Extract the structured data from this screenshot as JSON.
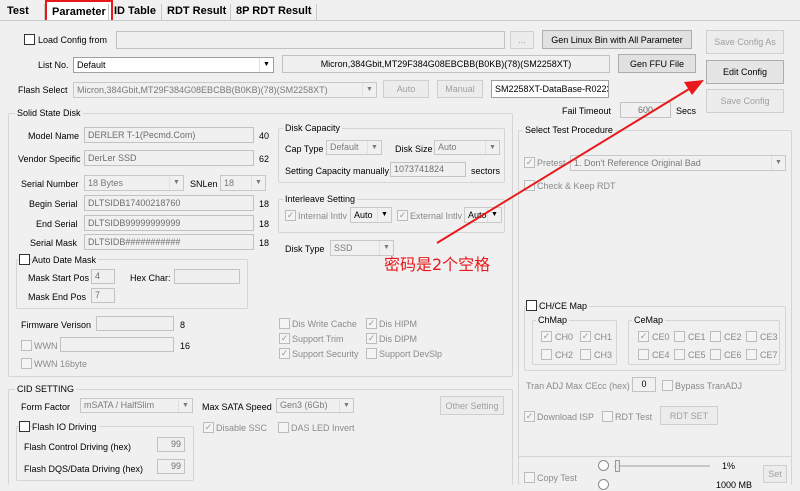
{
  "tabs": [
    "Test",
    "Parameter",
    "ID Table",
    "RDT Result",
    "8P RDT Result"
  ],
  "top": {
    "load_config_label": "Load Config from",
    "browse_label": "...",
    "gen_linux_label": "Gen Linux Bin with All Parameter",
    "save_config_as_label": "Save Config As",
    "list_no_label": "List No.",
    "list_no_value": "Default",
    "flash_info": "Micron,384Gbit,MT29F384G08EBCBB(B0KB)(78)(SM2258XT)",
    "gen_ffu_label": "Gen FFU File",
    "edit_config_label": "Edit Config",
    "flash_select_label": "Flash Select",
    "flash_select_value": "Micron,384Gbit,MT29F384G08EBCBB(B0KB)(78)(SM2258XT)",
    "auto_label": "Auto",
    "manual_label": "Manual",
    "database_value": "SM2258XT-DataBase-R0223",
    "save_config_label": "Save Config",
    "fail_timeout_label": "Fail Timeout",
    "fail_timeout_value": "600",
    "secs_label": "Secs"
  },
  "ssd": {
    "title": "Solid State Disk",
    "fields": [
      {
        "label": "Model Name",
        "value": "DERLER T-1(Pecmd.Com)",
        "num": "40"
      },
      {
        "label": "Vendor Specific",
        "value": "DerLer SSD",
        "num": "62"
      }
    ],
    "serial_label": "Serial Number",
    "serial_value": "18 Bytes",
    "snlen_label": "SNLen",
    "snlen_value": "18",
    "fields2": [
      {
        "label": "Begin Serial",
        "value": "DLTSIDB17400218760",
        "num": "18"
      },
      {
        "label": "End Serial",
        "value": "DLTSIDB99999999999",
        "num": "18"
      },
      {
        "label": "Serial Mask",
        "value": "DLTSIDB###########",
        "num": "18"
      }
    ],
    "auto_date_mask_label": "Auto Date Mask",
    "mask_start_label": "Mask Start Pos",
    "mask_start_value": "4",
    "hex_char_label": "Hex Char:",
    "mask_end_label": "Mask End Pos",
    "mask_end_value": "7",
    "capacity_title": "Disk Capacity",
    "cap_type_label": "Cap Type",
    "cap_type_value": "Default",
    "disk_size_label": "Disk Size",
    "disk_size_value": "Auto",
    "setting_cap_label": "Setting Capacity manually",
    "setting_cap_value": "1073741824",
    "sectors_label": "sectors",
    "interleave_title": "Interleave Setting",
    "internal_label": "Internal Intlv",
    "internal_value": "Auto",
    "external_label": "External Intlv",
    "external_value": "Auto",
    "disk_type_label": "Disk Type",
    "disk_type_value": "SSD",
    "fw_label": "Firmware Verison",
    "fw_num": "8",
    "wwn_label": "WWN",
    "wwn_num": "16",
    "wwn16_label": "WWN 16byte",
    "opts": [
      "Dis Write Cache",
      "Dis HIPM",
      "Support Trim",
      "Dis DIPM",
      "Support Security",
      "Support DevSlp"
    ]
  },
  "cid": {
    "title": "CID SETTING",
    "form_factor_label": "Form Factor",
    "form_factor_value": "mSATA / HalfSlim",
    "max_sata_label": "Max SATA Speed",
    "max_sata_value": "Gen3 (6Gb)",
    "other_setting_label": "Other Setting",
    "flash_io_label": "Flash IO Driving",
    "flash_ctrl_label": "Flash Control Driving (hex)",
    "flash_ctrl_value": "99",
    "flash_dqs_label": "Flash DQS/Data Driving (hex)",
    "flash_dqs_value": "99",
    "disable_ssc_label": "Disable SSC",
    "das_led_label": "DAS LED Invert"
  },
  "annotation": "密码是2个空格",
  "right": {
    "title": "Select Test Procedure",
    "pretest_label": "Pretest",
    "pretest_value": "1. Don't Reference Original Bad",
    "check_keep_label": "Check & Keep RDT",
    "chce_label": "CH/CE Map",
    "chmap_label": "ChMap",
    "cemap_label": "CeMap",
    "ch": [
      "CH0",
      "CH1",
      "CH2",
      "CH3"
    ],
    "ce": [
      "CE0",
      "CE1",
      "CE2",
      "CE3",
      "CE4",
      "CE5",
      "CE6",
      "CE7"
    ],
    "tran_adj_label": "Tran ADJ Max CEcc (hex)",
    "tran_adj_value": "0",
    "bypass_label": "Bypass TranADJ",
    "download_isp_label": "Download ISP",
    "rdt_test_label": "RDT Test",
    "rdt_set_label": "RDT SET",
    "copy_test_label": "Copy Test",
    "percent_label": "1%",
    "set_label": "Set",
    "mb_label": "1000 MB"
  },
  "colors": {
    "arrow": "#e8191c",
    "annotation": "#e8191c",
    "active_tab_border": "#e8191c"
  }
}
